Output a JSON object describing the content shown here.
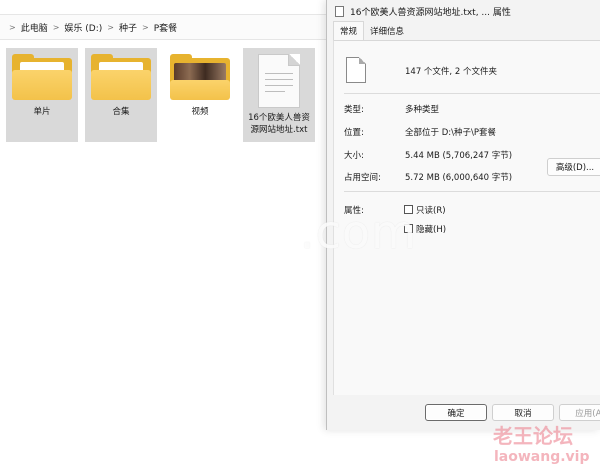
{
  "address": {
    "crumbs": [
      "此电脑",
      "娱乐 (D:)",
      "种子",
      "P套餐"
    ]
  },
  "files": [
    {
      "label": "单片",
      "kind": "folder"
    },
    {
      "label": "合集",
      "kind": "folder"
    },
    {
      "label": "视频",
      "kind": "folder-thumb"
    },
    {
      "label": "16个欧美人兽资源网站地址.txt",
      "kind": "txt"
    }
  ],
  "dialog": {
    "title": "16个欧美人兽资源网站地址.txt, ... 属性",
    "tabs": [
      "常规",
      "详细信息"
    ],
    "summary": "147 个文件, 2 个文件夹",
    "props": [
      {
        "key": "类型:",
        "value": "多种类型"
      },
      {
        "key": "位置:",
        "value": "全部位于 D:\\种子\\P套餐"
      },
      {
        "key": "大小:",
        "value": "5.44 MB (5,706,247 字节)"
      },
      {
        "key": "占用空间:",
        "value": "5.72 MB (6,000,640 字节)"
      }
    ],
    "attr_label": "属性:",
    "readonly_label": "只读(R)",
    "hidden_label": "隐藏(H)",
    "advanced_label": "高级(D)...",
    "ok_label": "确定",
    "cancel_label": "取消",
    "apply_label": "应用(A)"
  },
  "watermarks": {
    "site": ".com",
    "brand": "老王论坛",
    "domain": "laowang.vip"
  }
}
